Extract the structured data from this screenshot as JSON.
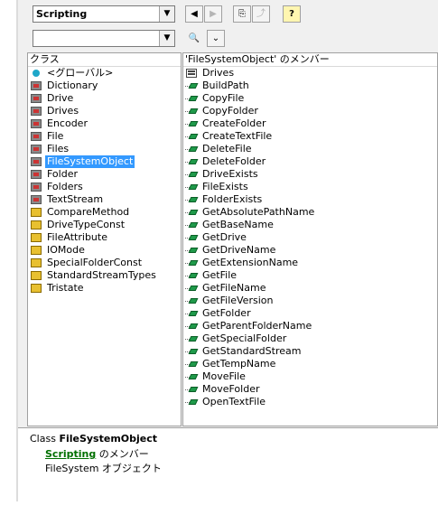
{
  "toolbar": {
    "library_combo": "Scripting",
    "search_combo": "",
    "nav_back": "◀",
    "nav_forward": "▶",
    "copy": "⎘",
    "view_def": "⤴",
    "help": "?",
    "search": "🔍",
    "toggle": "⌄"
  },
  "classes_pane": {
    "header": "クラス",
    "items": [
      {
        "label": "<グローバル>",
        "icon": "globe-icon",
        "selected": false
      },
      {
        "label": "Dictionary",
        "icon": "class-icon",
        "selected": false
      },
      {
        "label": "Drive",
        "icon": "class-icon",
        "selected": false
      },
      {
        "label": "Drives",
        "icon": "class-icon",
        "selected": false
      },
      {
        "label": "Encoder",
        "icon": "class-icon",
        "selected": false
      },
      {
        "label": "File",
        "icon": "class-icon",
        "selected": false
      },
      {
        "label": "Files",
        "icon": "class-icon",
        "selected": false
      },
      {
        "label": "FileSystemObject",
        "icon": "class-icon",
        "selected": true
      },
      {
        "label": "Folder",
        "icon": "class-icon",
        "selected": false
      },
      {
        "label": "Folders",
        "icon": "class-icon",
        "selected": false
      },
      {
        "label": "TextStream",
        "icon": "class-icon",
        "selected": false
      },
      {
        "label": "CompareMethod",
        "icon": "enum-icon",
        "selected": false
      },
      {
        "label": "DriveTypeConst",
        "icon": "enum-icon",
        "selected": false
      },
      {
        "label": "FileAttribute",
        "icon": "enum-icon",
        "selected": false
      },
      {
        "label": "IOMode",
        "icon": "enum-icon",
        "selected": false
      },
      {
        "label": "SpecialFolderConst",
        "icon": "enum-icon",
        "selected": false
      },
      {
        "label": "StandardStreamTypes",
        "icon": "enum-icon",
        "selected": false
      },
      {
        "label": "Tristate",
        "icon": "enum-icon",
        "selected": false
      }
    ]
  },
  "members_pane": {
    "header": "'FileSystemObject' のメンバー",
    "items": [
      {
        "label": "Drives",
        "icon": "property-icon"
      },
      {
        "label": "BuildPath",
        "icon": "method-icon"
      },
      {
        "label": "CopyFile",
        "icon": "method-icon"
      },
      {
        "label": "CopyFolder",
        "icon": "method-icon"
      },
      {
        "label": "CreateFolder",
        "icon": "method-icon"
      },
      {
        "label": "CreateTextFile",
        "icon": "method-icon"
      },
      {
        "label": "DeleteFile",
        "icon": "method-icon"
      },
      {
        "label": "DeleteFolder",
        "icon": "method-icon"
      },
      {
        "label": "DriveExists",
        "icon": "method-icon"
      },
      {
        "label": "FileExists",
        "icon": "method-icon"
      },
      {
        "label": "FolderExists",
        "icon": "method-icon"
      },
      {
        "label": "GetAbsolutePathName",
        "icon": "method-icon"
      },
      {
        "label": "GetBaseName",
        "icon": "method-icon"
      },
      {
        "label": "GetDrive",
        "icon": "method-icon"
      },
      {
        "label": "GetDriveName",
        "icon": "method-icon"
      },
      {
        "label": "GetExtensionName",
        "icon": "method-icon"
      },
      {
        "label": "GetFile",
        "icon": "method-icon"
      },
      {
        "label": "GetFileName",
        "icon": "method-icon"
      },
      {
        "label": "GetFileVersion",
        "icon": "method-icon"
      },
      {
        "label": "GetFolder",
        "icon": "method-icon"
      },
      {
        "label": "GetParentFolderName",
        "icon": "method-icon"
      },
      {
        "label": "GetSpecialFolder",
        "icon": "method-icon"
      },
      {
        "label": "GetStandardStream",
        "icon": "method-icon"
      },
      {
        "label": "GetTempName",
        "icon": "method-icon"
      },
      {
        "label": "MoveFile",
        "icon": "method-icon"
      },
      {
        "label": "MoveFolder",
        "icon": "method-icon"
      },
      {
        "label": "OpenTextFile",
        "icon": "method-icon"
      }
    ]
  },
  "details": {
    "kind": "Class",
    "name": "FileSystemObject",
    "library_link": "Scripting",
    "member_of_suffix": "のメンバー",
    "description": "FileSystem オブジェクト"
  }
}
